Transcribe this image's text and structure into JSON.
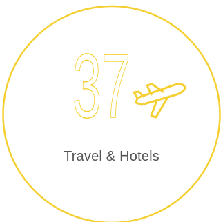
{
  "tile": {
    "number": "37",
    "label": "Travel & Hotels",
    "icon": "airplane-icon"
  },
  "colors": {
    "accent": "#f5cf2f",
    "label_text": "#555555",
    "background": "#ffffff"
  }
}
